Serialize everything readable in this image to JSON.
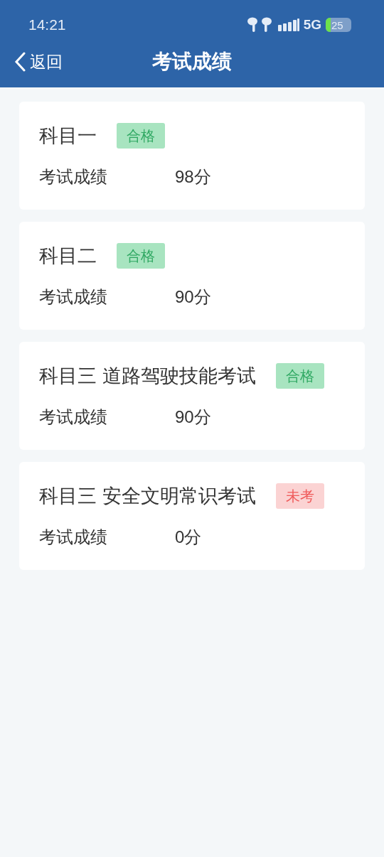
{
  "status_bar": {
    "time": "14:21",
    "network": "5G",
    "battery": "25"
  },
  "header": {
    "back": "返回",
    "title": "考试成绩"
  },
  "results": [
    {
      "subject": "科目一",
      "badge": {
        "kind": "passed",
        "label": "合格"
      },
      "score_label": "考试成绩",
      "score": "98分"
    },
    {
      "subject": "科目二",
      "badge": {
        "kind": "passed",
        "label": "合格"
      },
      "score_label": "考试成绩",
      "score": "90分"
    },
    {
      "subject": "科目三 道路驾驶技能考试",
      "badge": {
        "kind": "passed",
        "label": "合格"
      },
      "score_label": "考试成绩",
      "score": "90分"
    },
    {
      "subject": "科目三 安全文明常识考试",
      "badge": {
        "kind": "not_taken",
        "label": "未考"
      },
      "score_label": "考试成绩",
      "score": "0分"
    }
  ]
}
